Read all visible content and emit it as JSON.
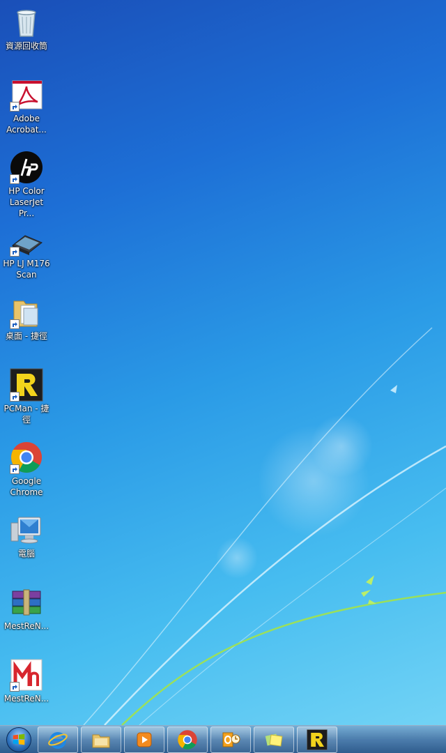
{
  "desktop": {
    "icons": [
      {
        "label": "資源回收筒",
        "icon": "recycle-bin-icon",
        "shortcut": false
      },
      {
        "label": "Adobe Acrobat...",
        "icon": "adobe-acrobat-icon",
        "shortcut": true
      },
      {
        "label": "HP Color LaserJet Pr...",
        "icon": "hp-logo-icon",
        "shortcut": true
      },
      {
        "label": "HP LJ M176 Scan",
        "icon": "scanner-icon",
        "shortcut": true
      },
      {
        "label": "桌面 - 捷徑",
        "icon": "folder-icon",
        "shortcut": true
      },
      {
        "label": "PCMan - 捷徑",
        "icon": "pcman-icon",
        "shortcut": true
      },
      {
        "label": "Google Chrome",
        "icon": "chrome-icon",
        "shortcut": true
      },
      {
        "label": "電腦",
        "icon": "computer-icon",
        "shortcut": false
      },
      {
        "label": "MestReN...",
        "icon": "winrar-icon",
        "shortcut": false
      },
      {
        "label": "MestReN...",
        "icon": "mestrenova-icon",
        "shortcut": true
      }
    ]
  },
  "taskbar": {
    "start": {
      "icon": "windows-start-orb-icon"
    },
    "pinned": [
      {
        "icon": "internet-explorer-icon"
      },
      {
        "icon": "file-explorer-icon"
      },
      {
        "icon": "media-player-icon"
      },
      {
        "icon": "chrome-icon"
      },
      {
        "icon": "outlook-icon"
      },
      {
        "icon": "sticky-notes-icon"
      },
      {
        "icon": "pcman-icon"
      }
    ]
  },
  "colors": {
    "wallpaper_top": "#1a4fb8",
    "wallpaper_bottom": "#78d6f6",
    "label_text": "#ffffff"
  }
}
